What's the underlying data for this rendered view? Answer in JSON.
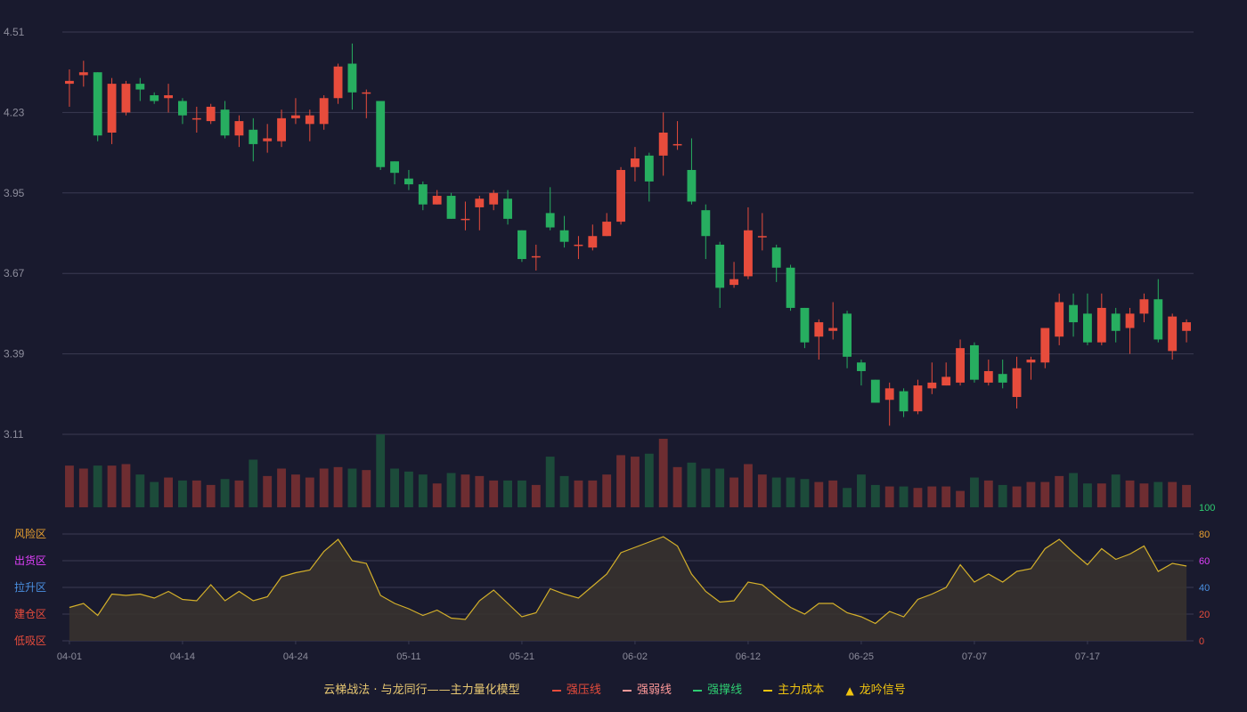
{
  "chart_data": {
    "type": "candlestick",
    "x_tick_labels": [
      "04-01",
      "04-14",
      "04-24",
      "05-11",
      "05-21",
      "06-02",
      "06-12",
      "06-25",
      "07-07",
      "07-17"
    ],
    "x_tick_index": [
      0,
      8,
      16,
      24,
      32,
      40,
      48,
      56,
      64,
      72
    ],
    "price_axis": {
      "ticks": [
        "4.51",
        "4.23",
        "3.95",
        "3.67",
        "3.39",
        "3.11"
      ],
      "ylim": [
        3.11,
        4.51
      ]
    },
    "candles": [
      [
        4.33,
        4.34,
        4.25,
        4.38
      ],
      [
        4.36,
        4.37,
        4.32,
        4.41
      ],
      [
        4.37,
        4.15,
        4.13,
        4.37
      ],
      [
        4.16,
        4.33,
        4.12,
        4.35
      ],
      [
        4.23,
        4.33,
        4.22,
        4.34
      ],
      [
        4.33,
        4.31,
        4.27,
        4.35
      ],
      [
        4.29,
        4.27,
        4.26,
        4.3
      ],
      [
        4.28,
        4.29,
        4.23,
        4.33
      ],
      [
        4.27,
        4.22,
        4.19,
        4.28
      ],
      [
        4.21,
        4.21,
        4.16,
        4.25
      ],
      [
        4.2,
        4.25,
        4.19,
        4.26
      ],
      [
        4.24,
        4.15,
        4.14,
        4.27
      ],
      [
        4.15,
        4.2,
        4.11,
        4.22
      ],
      [
        4.17,
        4.12,
        4.06,
        4.21
      ],
      [
        4.13,
        4.14,
        4.09,
        4.19
      ],
      [
        4.13,
        4.21,
        4.11,
        4.24
      ],
      [
        4.21,
        4.22,
        4.19,
        4.28
      ],
      [
        4.19,
        4.22,
        4.13,
        4.24
      ],
      [
        4.19,
        4.28,
        4.17,
        4.29
      ],
      [
        4.28,
        4.39,
        4.26,
        4.4
      ],
      [
        4.4,
        4.3,
        4.24,
        4.47
      ],
      [
        4.3,
        4.3,
        4.21,
        4.31
      ],
      [
        4.27,
        4.04,
        4.03,
        4.27
      ],
      [
        4.06,
        4.02,
        3.98,
        4.06
      ],
      [
        4.0,
        3.98,
        3.96,
        4.03
      ],
      [
        3.98,
        3.91,
        3.89,
        3.99
      ],
      [
        3.91,
        3.94,
        3.91,
        3.96
      ],
      [
        3.94,
        3.86,
        3.86,
        3.95
      ],
      [
        3.86,
        3.86,
        3.82,
        3.92
      ],
      [
        3.9,
        3.93,
        3.82,
        3.94
      ],
      [
        3.91,
        3.95,
        3.89,
        3.96
      ],
      [
        3.93,
        3.86,
        3.84,
        3.96
      ],
      [
        3.82,
        3.72,
        3.71,
        3.82
      ],
      [
        3.73,
        3.73,
        3.68,
        3.77
      ],
      [
        3.88,
        3.83,
        3.82,
        3.97
      ],
      [
        3.82,
        3.78,
        3.76,
        3.87
      ],
      [
        3.77,
        3.77,
        3.72,
        3.8
      ],
      [
        3.76,
        3.8,
        3.75,
        3.84
      ],
      [
        3.8,
        3.85,
        3.8,
        3.88
      ],
      [
        3.85,
        4.03,
        3.84,
        4.04
      ],
      [
        4.04,
        4.07,
        3.99,
        4.11
      ],
      [
        4.08,
        3.99,
        3.92,
        4.09
      ],
      [
        4.08,
        4.16,
        4.01,
        4.23
      ],
      [
        4.12,
        4.12,
        4.1,
        4.2
      ],
      [
        4.03,
        3.92,
        3.91,
        4.14
      ],
      [
        3.89,
        3.8,
        3.72,
        3.91
      ],
      [
        3.77,
        3.62,
        3.55,
        3.78
      ],
      [
        3.63,
        3.65,
        3.62,
        3.71
      ],
      [
        3.66,
        3.82,
        3.65,
        3.9
      ],
      [
        3.8,
        3.8,
        3.75,
        3.88
      ],
      [
        3.76,
        3.69,
        3.64,
        3.77
      ],
      [
        3.69,
        3.55,
        3.54,
        3.7
      ],
      [
        3.55,
        3.43,
        3.41,
        3.55
      ],
      [
        3.45,
        3.5,
        3.37,
        3.51
      ],
      [
        3.47,
        3.48,
        3.44,
        3.57
      ],
      [
        3.53,
        3.38,
        3.34,
        3.54
      ],
      [
        3.36,
        3.33,
        3.28,
        3.37
      ],
      [
        3.3,
        3.22,
        3.22,
        3.3
      ],
      [
        3.23,
        3.27,
        3.14,
        3.29
      ],
      [
        3.26,
        3.19,
        3.17,
        3.27
      ],
      [
        3.19,
        3.28,
        3.18,
        3.3
      ],
      [
        3.27,
        3.29,
        3.25,
        3.36
      ],
      [
        3.28,
        3.31,
        3.28,
        3.36
      ],
      [
        3.29,
        3.41,
        3.28,
        3.44
      ],
      [
        3.42,
        3.3,
        3.29,
        3.43
      ],
      [
        3.29,
        3.33,
        3.28,
        3.37
      ],
      [
        3.32,
        3.29,
        3.27,
        3.37
      ],
      [
        3.24,
        3.34,
        3.2,
        3.38
      ],
      [
        3.36,
        3.37,
        3.3,
        3.38
      ],
      [
        3.36,
        3.48,
        3.34,
        3.48
      ],
      [
        3.45,
        3.57,
        3.42,
        3.6
      ],
      [
        3.56,
        3.5,
        3.45,
        3.6
      ],
      [
        3.53,
        3.43,
        3.42,
        3.6
      ],
      [
        3.43,
        3.55,
        3.42,
        3.6
      ],
      [
        3.53,
        3.47,
        3.43,
        3.55
      ],
      [
        3.48,
        3.53,
        3.39,
        3.55
      ],
      [
        3.53,
        3.58,
        3.5,
        3.6
      ],
      [
        3.58,
        3.44,
        3.43,
        3.65
      ],
      [
        3.4,
        3.52,
        3.37,
        3.53
      ],
      [
        3.47,
        3.5,
        3.43,
        3.51
      ]
    ],
    "volume": [
      28,
      26,
      28,
      28,
      29,
      22,
      17,
      20,
      18,
      18,
      15,
      19,
      18,
      32,
      21,
      26,
      22,
      20,
      26,
      27,
      26,
      25,
      49,
      26,
      24,
      22,
      16,
      23,
      22,
      21,
      18,
      18,
      18,
      15,
      34,
      21,
      18,
      18,
      22,
      35,
      34,
      36,
      46,
      27,
      30,
      26,
      26,
      20,
      29,
      22,
      20,
      20,
      19,
      17,
      18,
      13,
      22,
      15,
      14,
      14,
      13,
      14,
      14,
      11,
      20,
      18,
      15,
      14,
      17,
      17,
      21,
      23,
      16,
      16,
      22,
      18,
      16,
      17,
      17,
      15,
      13
    ],
    "indicator": [
      25,
      28,
      19,
      35,
      34,
      35,
      32,
      37,
      31,
      30,
      42,
      30,
      37,
      30,
      33,
      48,
      51,
      53,
      67,
      76,
      60,
      58,
      34,
      28,
      24,
      19,
      23,
      17,
      16,
      30,
      38,
      28,
      18,
      21,
      39,
      35,
      32,
      41,
      50,
      66,
      70,
      74,
      78,
      71,
      50,
      37,
      29,
      30,
      44,
      42,
      33,
      25,
      20,
      28,
      28,
      21,
      18,
      13,
      22,
      18,
      31,
      35,
      40,
      57,
      44,
      50,
      44,
      52,
      54,
      69,
      76,
      66,
      57,
      69,
      61,
      65,
      71,
      52,
      58,
      56
    ],
    "indicator_axis": {
      "ticks": [
        "0",
        "20",
        "40",
        "60",
        "80",
        "100"
      ],
      "ylim": [
        0,
        100
      ]
    },
    "zones": [
      "低吸区",
      "建仓区",
      "拉升区",
      "出货区",
      "风险区"
    ],
    "colors": {
      "up": "#e74c3c",
      "down": "#27ae60",
      "volume_up": "#6e2d31",
      "volume_down": "#1c4b3a",
      "indicator_line": "#d4b02a",
      "indicator_fill": "#3a342e",
      "grid": "#3a3b52",
      "axis_text": "#8d8d9c",
      "zone_colors": [
        "#e74c3c",
        "#e74c3c",
        "#4a90e2",
        "#e040fb",
        "#e8a030"
      ],
      "tick_colors": [
        "#e74c3c",
        "#e74c3c",
        "#4a90e2",
        "#e040fb",
        "#e8a030",
        "#2ecc71"
      ]
    }
  },
  "legend": {
    "title": "云梯战法 · 与龙同行——主力量化模型",
    "items": [
      {
        "label": "强压线",
        "color": "#e74c3c",
        "style": "solid"
      },
      {
        "label": "强弱线",
        "color": "#ff9999",
        "style": "dashed"
      },
      {
        "label": "强撑线",
        "color": "#2ecc71",
        "style": "solid"
      },
      {
        "label": "主力成本",
        "color": "#f1c40f",
        "style": "dashed"
      },
      {
        "label": "龙吟信号",
        "color": "#f1c40f",
        "style": "triangle"
      }
    ]
  }
}
